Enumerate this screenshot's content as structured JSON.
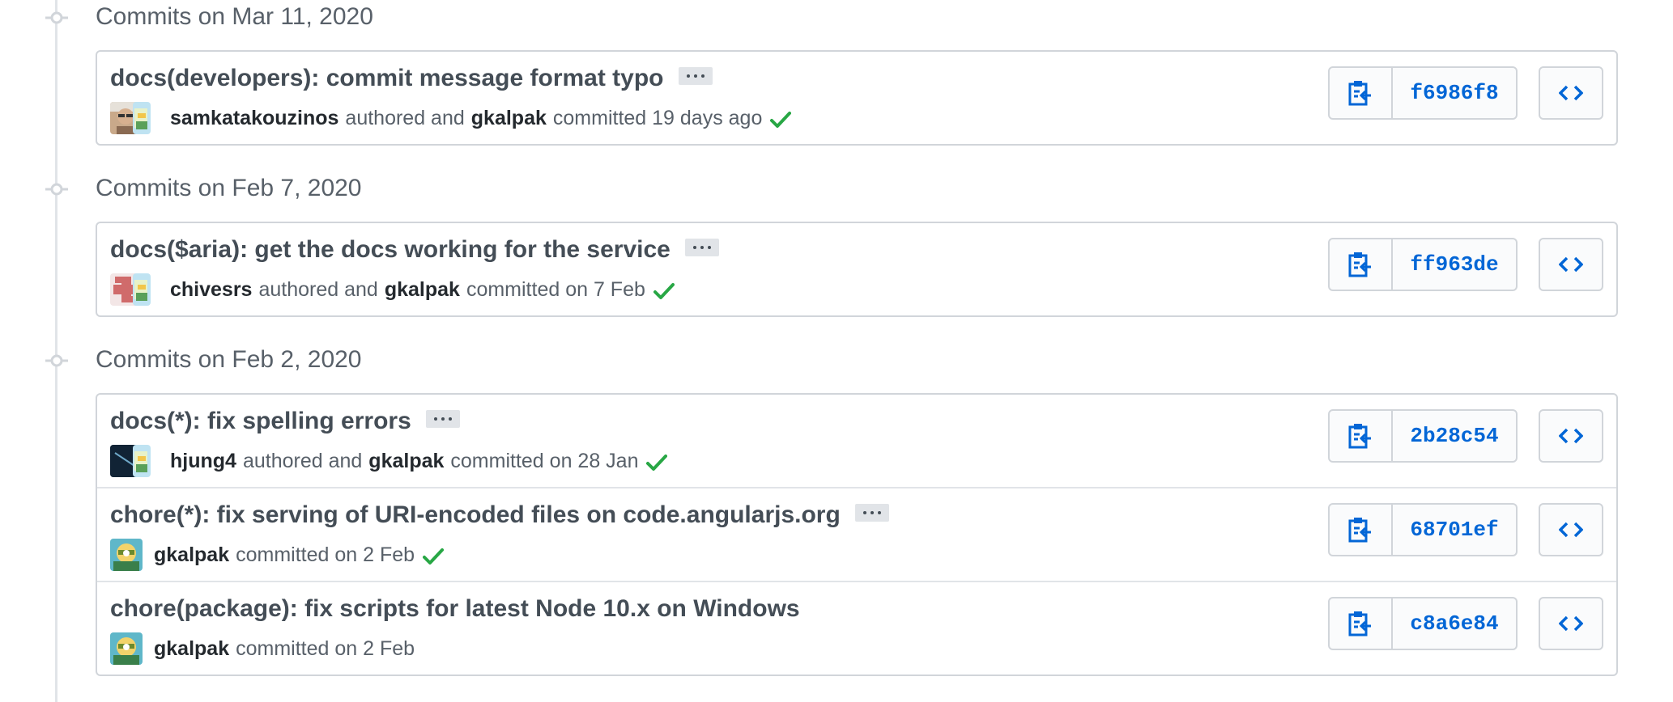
{
  "groups": [
    {
      "title": "Commits on Mar 11, 2020",
      "commits": [
        {
          "message": "docs(developers): commit message format typo",
          "has_ellipsis": true,
          "author": "samkatakouzinos",
          "authored_text": "authored and",
          "committer": "gkalpak",
          "committed_text": "committed 19 days ago",
          "verified": true,
          "sha": "f6986f8"
        }
      ]
    },
    {
      "title": "Commits on Feb 7, 2020",
      "commits": [
        {
          "message": "docs($aria): get the docs working for the service",
          "has_ellipsis": true,
          "author": "chivesrs",
          "authored_text": "authored and",
          "committer": "gkalpak",
          "committed_text": "committed on 7 Feb",
          "verified": true,
          "sha": "ff963de"
        }
      ]
    },
    {
      "title": "Commits on Feb 2, 2020",
      "commits": [
        {
          "message": "docs(*): fix spelling errors",
          "has_ellipsis": true,
          "author": "hjung4",
          "authored_text": "authored and",
          "committer": "gkalpak",
          "committed_text": "committed on 28 Jan",
          "verified": true,
          "sha": "2b28c54"
        },
        {
          "message": "chore(*): fix serving of URI-encoded files on code.angularjs.org",
          "has_ellipsis": true,
          "committer": "gkalpak",
          "committed_text": "committed on 2 Feb",
          "verified": true,
          "sha": "68701ef"
        },
        {
          "message": "chore(package): fix scripts for latest Node 10.x on Windows",
          "has_ellipsis": false,
          "committer": "gkalpak",
          "committed_text": "committed on 2 Feb",
          "verified": false,
          "sha": "c8a6e84"
        }
      ]
    }
  ],
  "icons": {
    "timeline": "git-commit-icon",
    "copy": "clippy-icon",
    "browse": "code-icon",
    "verified": "check-icon",
    "more": "ellipsis-icon"
  },
  "colors": {
    "sha_link": "#0366d6",
    "verified_check": "#28a745",
    "group_title": "#586069",
    "message": "#444d56"
  }
}
